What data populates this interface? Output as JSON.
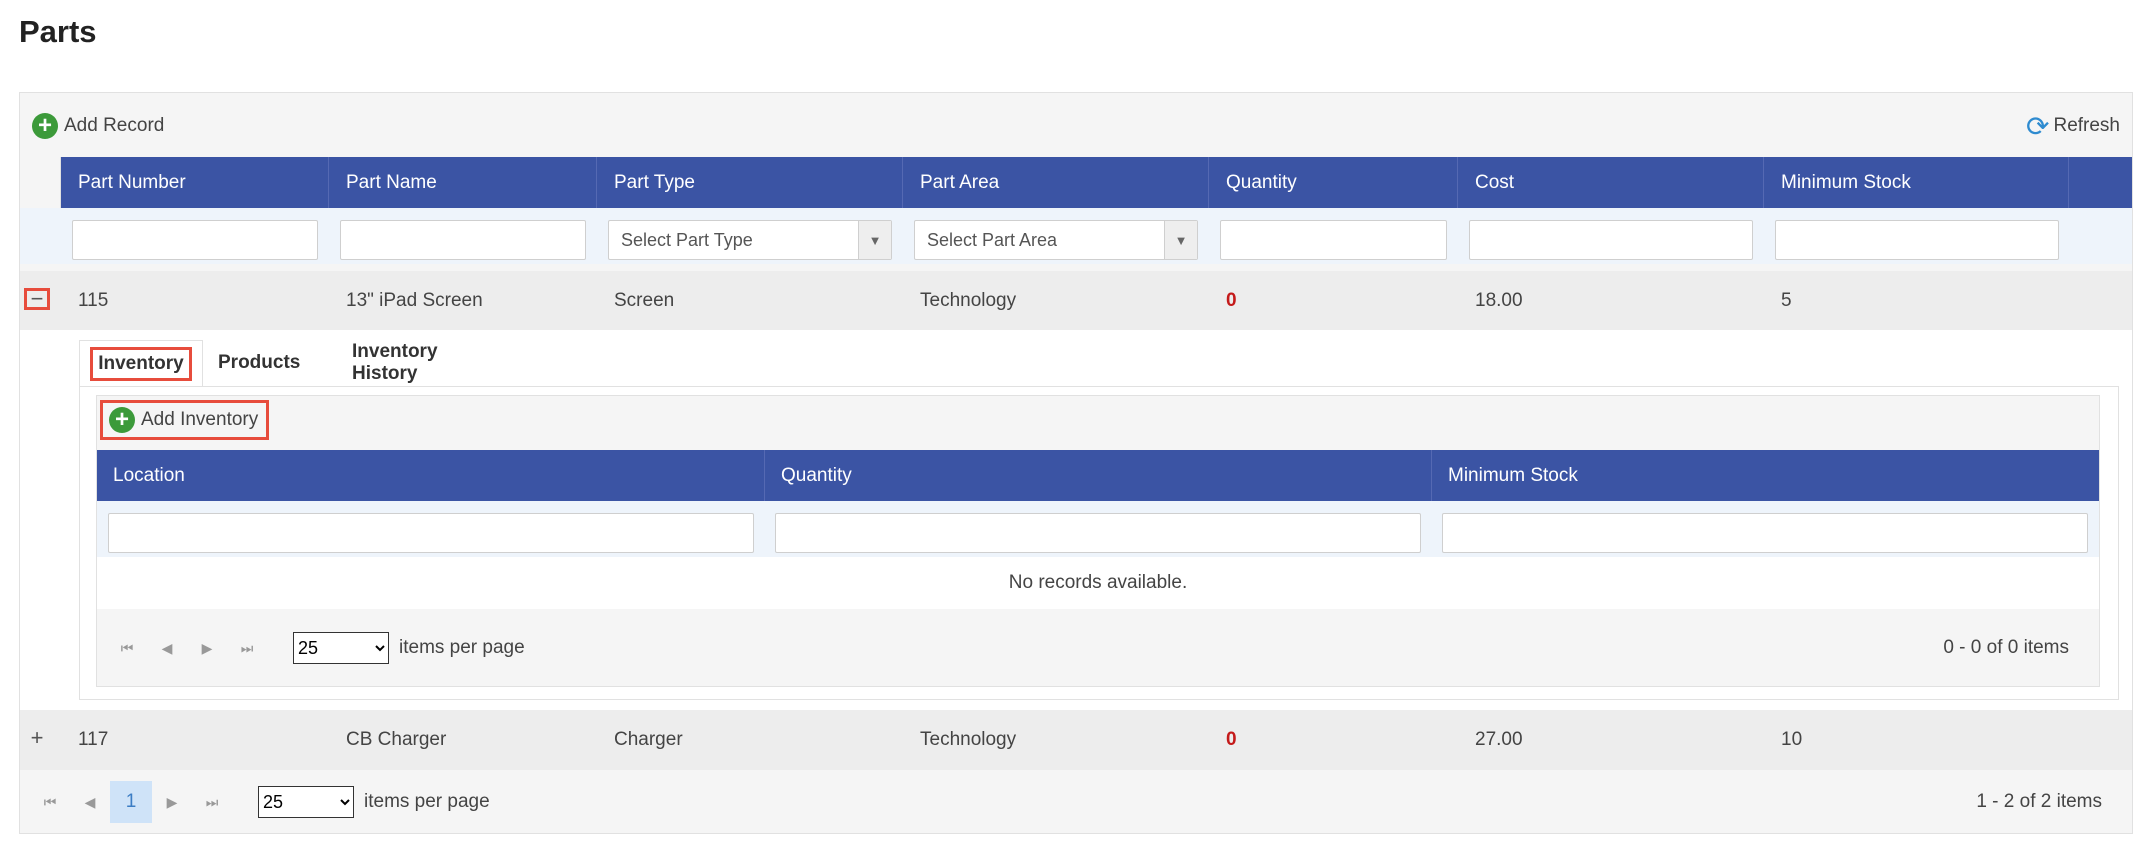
{
  "page": {
    "title": "Parts"
  },
  "toolbar": {
    "add_label": "Add Record",
    "refresh_label": "Refresh"
  },
  "columns": [
    "Part Number",
    "Part Name",
    "Part Type",
    "Part Area",
    "Quantity",
    "Cost",
    "Minimum Stock"
  ],
  "filters": {
    "part_type_placeholder": "Select Part Type",
    "part_area_placeholder": "Select Part Area"
  },
  "rows": [
    {
      "part_number": "115",
      "part_name": "13\" iPad Screen",
      "part_type": "Screen",
      "part_area": "Technology",
      "quantity": "0",
      "cost": "18.00",
      "min_stock": "5",
      "expanded": true,
      "expander": "−"
    },
    {
      "part_number": "117",
      "part_name": "CB Charger",
      "part_type": "Charger",
      "part_area": "Technology",
      "quantity": "0",
      "cost": "27.00",
      "min_stock": "10",
      "expanded": false,
      "expander": "+"
    }
  ],
  "detail": {
    "tabs": [
      "Inventory",
      "Products",
      "Inventory History"
    ],
    "active_tab": "Inventory",
    "add_label": "Add Inventory",
    "columns": [
      "Location",
      "Quantity",
      "Minimum Stock"
    ],
    "empty_message": "No records available.",
    "pager": {
      "page_size": "25",
      "items_per_page_label": "items per page",
      "info": "0 - 0 of 0 items"
    }
  },
  "pager": {
    "current_page": "1",
    "page_size": "25",
    "items_per_page_label": "items per page",
    "info": "1 - 2 of 2 items"
  },
  "colors": {
    "header": "#3b54a4",
    "accent_green": "#3c9a3a",
    "highlight_red": "#e74c3c",
    "zero_qty": "#c41a1a"
  }
}
